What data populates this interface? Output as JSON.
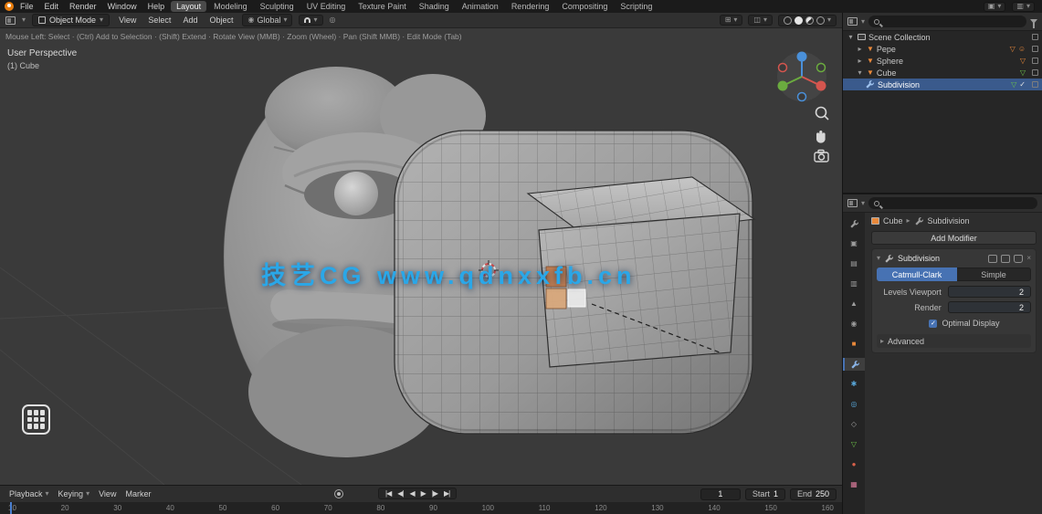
{
  "icons": {
    "chevron_down": "▾",
    "caret_right": "▸",
    "check": "✓",
    "close": "×",
    "mesh_obj": "▼",
    "mesh_data": "▽",
    "smiley": "☺",
    "obj_square": "■",
    "world": "◉",
    "render_cam": "▣",
    "output": "▤",
    "viewlayer": "▥",
    "scene_tab": "▲",
    "particles": "✱",
    "physics": "◎",
    "constraints": "◇",
    "material": "●",
    "texture": "▦",
    "prop_edit": "◎",
    "overlay": "◫",
    "grid4": "⊞",
    "dot": "●",
    "ring": "○"
  },
  "topbar": {
    "menus": [
      "File",
      "Edit",
      "Render",
      "Window",
      "Help"
    ],
    "workspaces": [
      "Layout",
      "Modeling",
      "Sculpting",
      "UV Editing",
      "Texture Paint",
      "Shading",
      "Animation",
      "Rendering",
      "Compositing",
      "Scripting"
    ],
    "active_workspace": "Layout"
  },
  "viewport_header": {
    "mode": "Object Mode",
    "menus": [
      "View",
      "Select",
      "Add",
      "Object"
    ],
    "orientation": "Global"
  },
  "viewport": {
    "hint": "Mouse Left: Select · (Ctrl) Add to Selection · (Shift) Extend · Rotate View (MMB) · Zoom (Wheel) · Pan (Shift MMB) · Edit Mode (Tab)",
    "view_label": "User Perspective",
    "active_object": "(1) Cube",
    "watermark": "技艺CG  www.qdnxxfb.cn"
  },
  "outliner": {
    "rows": [
      {
        "label": "Scene Collection"
      },
      {
        "label": "Pepe"
      },
      {
        "label": "Sphere"
      },
      {
        "label": "Cube"
      },
      {
        "label": "Subdivision"
      }
    ]
  },
  "properties": {
    "breadcrumb_object": "Cube",
    "breadcrumb_item": "Subdivision",
    "add_modifier": "Add Modifier",
    "modifier_name": "Subdivision",
    "algo_left": "Catmull-Clark",
    "algo_right": "Simple",
    "levels_label": "Levels Viewport",
    "levels_value": "2",
    "render_label": "Render",
    "render_value": "2",
    "optimal_display": "Optimal Display",
    "advanced": "Advanced"
  },
  "timeline": {
    "menus": [
      "Playback",
      "Keying",
      "View",
      "Marker"
    ],
    "jump_start": "|◀",
    "prev_key": "◀|",
    "play_rev": "◀",
    "play": "▶",
    "next_key": "|▶",
    "jump_end": "▶|",
    "frame": "1",
    "start_label": "Start",
    "start_value": "1",
    "end_label": "End",
    "end_value": "250",
    "ruler": [
      "10",
      "20",
      "30",
      "40",
      "50",
      "60",
      "70",
      "80",
      "90",
      "100",
      "110",
      "120",
      "130",
      "140",
      "150",
      "160"
    ]
  },
  "colors": {
    "accent": "#4772b3",
    "object_orange": "#e8883a",
    "watermark_blue": "#2aa7e8"
  }
}
